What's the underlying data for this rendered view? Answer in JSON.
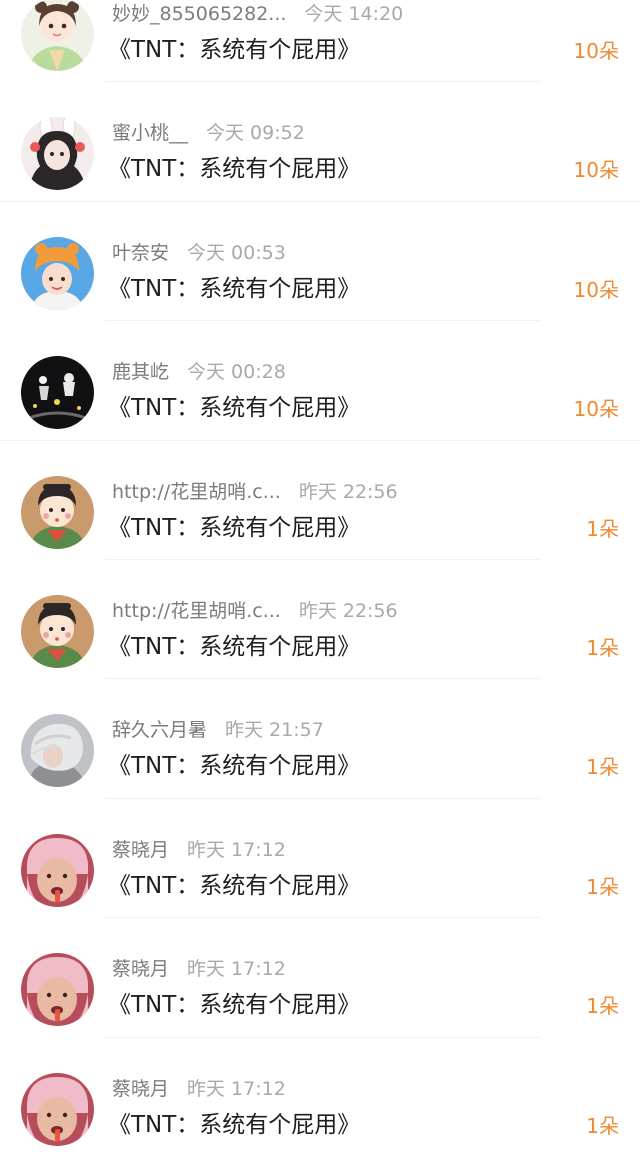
{
  "gifts": [
    {
      "name": "妙妙_855065282...",
      "time": "今天 14:20",
      "work": "《TNT：系统有个屁用》",
      "count": "10朵",
      "avatar": "girl-hanfu-avatar"
    },
    {
      "name": "蜜小桃__",
      "time": "今天 09:52",
      "work": "《TNT：系统有个屁用》",
      "count": "10朵",
      "avatar": "girl-bunny-ears-avatar"
    },
    {
      "name": "叶奈安",
      "time": "今天 00:53",
      "work": "《TNT：系统有个屁用》",
      "count": "10朵",
      "avatar": "boy-orange-hat-avatar"
    },
    {
      "name": "鹿其屹",
      "time": "今天 00:28",
      "work": "《TNT：系统有个屁用》",
      "count": "10朵",
      "avatar": "stage-group-avatar"
    },
    {
      "name": "http://花里胡哨.c...",
      "time": "昨天 22:56",
      "work": "《TNT：系统有个屁用》",
      "count": "1朵",
      "avatar": "cartoon-chinese-doll-avatar"
    },
    {
      "name": "http://花里胡哨.c...",
      "time": "昨天 22:56",
      "work": "《TNT：系统有个屁用》",
      "count": "1朵",
      "avatar": "cartoon-chinese-doll-avatar"
    },
    {
      "name": "辞久六月暑",
      "time": "昨天 21:57",
      "work": "《TNT：系统有个屁用》",
      "count": "1朵",
      "avatar": "silver-hair-avatar"
    },
    {
      "name": "蔡晓月",
      "time": "昨天 17:12",
      "work": "《TNT：系统有个屁用》",
      "count": "1朵",
      "avatar": "pink-hat-face-avatar"
    },
    {
      "name": "蔡晓月",
      "time": "昨天 17:12",
      "work": "《TNT：系统有个屁用》",
      "count": "1朵",
      "avatar": "pink-hat-face-avatar"
    },
    {
      "name": "蔡晓月",
      "time": "昨天 17:12",
      "work": "《TNT：系统有个屁用》",
      "count": "1朵",
      "avatar": "pink-hat-face-avatar"
    }
  ]
}
